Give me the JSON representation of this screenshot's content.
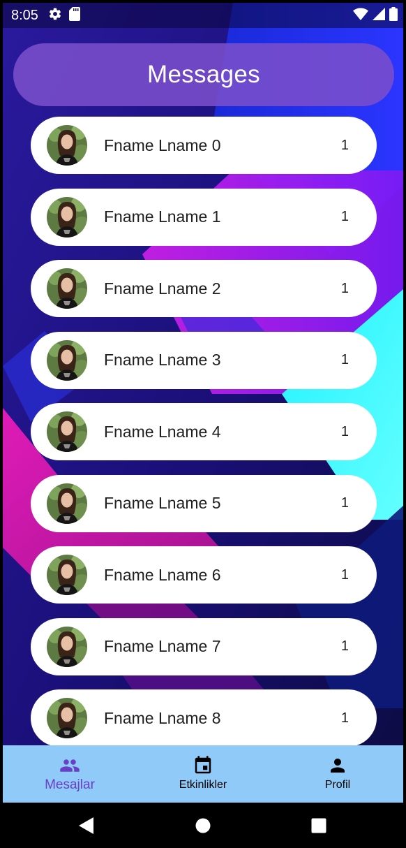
{
  "status_bar": {
    "time": "8:05",
    "left_icons": [
      "settings-icon",
      "sd-card-icon"
    ],
    "right_icons": [
      "wifi-icon",
      "signal-icon",
      "battery-icon"
    ]
  },
  "header": {
    "title": "Messages"
  },
  "messages": [
    {
      "name": "Fname Lname 0",
      "count": "1"
    },
    {
      "name": "Fname Lname 1",
      "count": "1"
    },
    {
      "name": "Fname Lname 2",
      "count": "1"
    },
    {
      "name": "Fname Lname 3",
      "count": "1"
    },
    {
      "name": "Fname Lname 4",
      "count": "1"
    },
    {
      "name": "Fname Lname 5",
      "count": "1"
    },
    {
      "name": "Fname Lname 6",
      "count": "1"
    },
    {
      "name": "Fname Lname 7",
      "count": "1"
    },
    {
      "name": "Fname Lname 8",
      "count": "1"
    }
  ],
  "bottom_nav": {
    "items": [
      {
        "label": "Mesajlar",
        "icon": "people-icon",
        "active": true
      },
      {
        "label": "Etkinlikler",
        "icon": "calendar-event-icon",
        "active": false
      },
      {
        "label": "Profil",
        "icon": "person-icon",
        "active": false
      }
    ]
  },
  "system_nav": {
    "icons": [
      "back-icon",
      "home-icon",
      "recents-icon"
    ]
  },
  "colors": {
    "header_pill": "#7a4ecc",
    "bottom_nav_bg": "#90caf9",
    "active_nav": "#6a3fc7",
    "list_item_bg": "#ffffff"
  }
}
